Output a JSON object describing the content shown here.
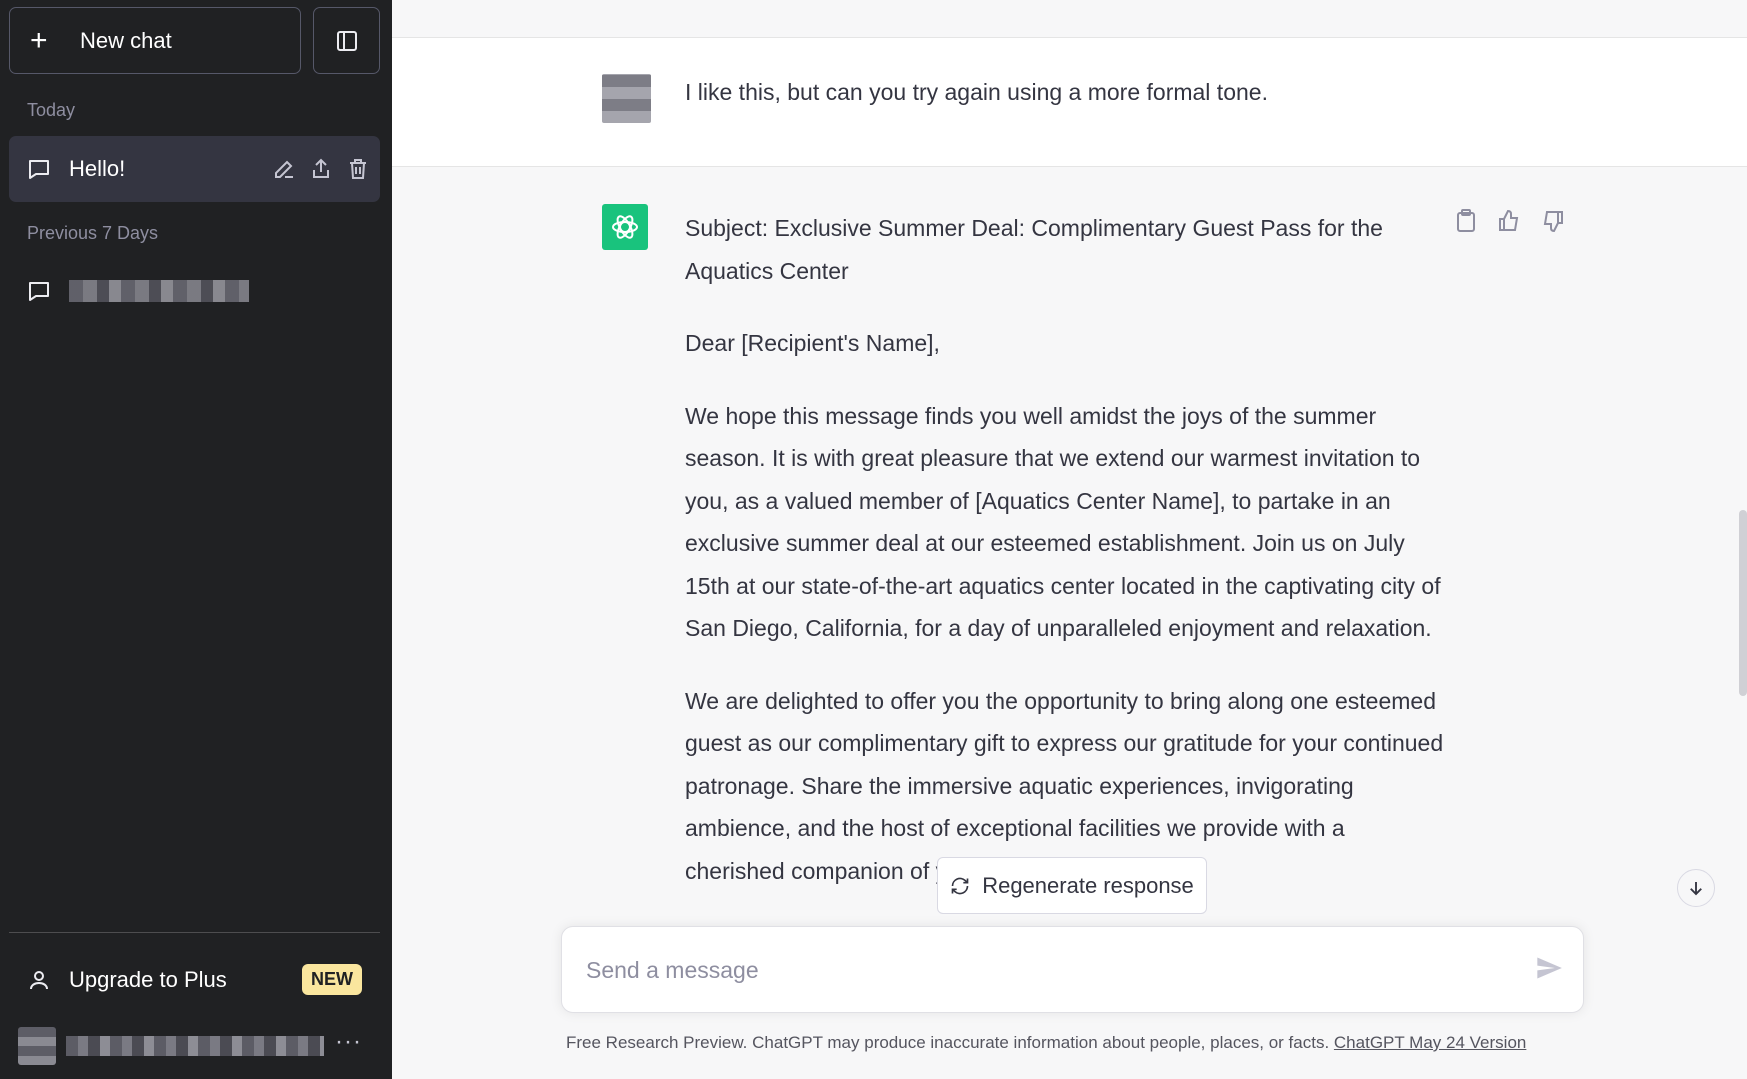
{
  "sidebar": {
    "new_chat_label": "New chat",
    "sections": [
      {
        "label": "Today",
        "items": [
          {
            "label": "Hello!"
          }
        ]
      },
      {
        "label": "Previous 7 Days",
        "items": [
          {
            "label": ""
          }
        ]
      }
    ],
    "upgrade_label": "Upgrade to Plus",
    "upgrade_badge": "NEW"
  },
  "conversation": {
    "user_message": "I like this, but can you try again using a more formal tone.",
    "assistant_paragraphs": [
      "Subject: Exclusive Summer Deal: Complimentary Guest Pass for the Aquatics Center",
      "Dear [Recipient's Name],",
      "We hope this message finds you well amidst the joys of the summer season. It is with great pleasure that we extend our warmest invitation to you, as a valued member of [Aquatics Center Name], to partake in an exclusive summer deal at our esteemed establishment. Join us on July 15th at our state-of-the-art aquatics center located in the captivating city of San Diego, California, for a day of unparalleled enjoyment and relaxation.",
      "We are delighted to offer you the opportunity to bring along one esteemed guest as our complimentary gift to express our gratitude for your continued patronage. Share the immersive aquatic experiences, invigorating ambience, and the host of exceptional facilities we provide with a cherished companion of your"
    ]
  },
  "regenerate_label": "Regenerate response",
  "input": {
    "placeholder": "Send a message"
  },
  "footer": {
    "text": "Free Research Preview. ChatGPT may produce inaccurate information about people, places, or facts. ",
    "link": "ChatGPT May 24 Version"
  },
  "colors": {
    "sidebar_bg": "#202123",
    "accent": "#19c37d",
    "badge": "#fae69e"
  },
  "icons": [
    "plus-icon",
    "sidebar-toggle-icon",
    "chat-bubble-icon",
    "edit-icon",
    "share-icon",
    "trash-icon",
    "user-icon",
    "more-dots-icon",
    "openai-logo-icon",
    "copy-icon",
    "thumbs-up-icon",
    "thumbs-down-icon",
    "refresh-icon",
    "arrow-down-icon",
    "send-icon"
  ]
}
